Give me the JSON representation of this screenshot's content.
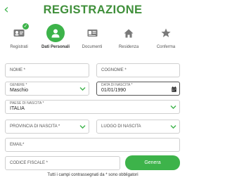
{
  "header": {
    "back_glyph": "‹",
    "title": "REGISTRAZIONE"
  },
  "steps": [
    {
      "label": "Registrati",
      "icon": "id-card-icon",
      "state": "done"
    },
    {
      "label": "Dati Personali",
      "icon": "user-icon",
      "state": "active"
    },
    {
      "label": "Documenti",
      "icon": "document-icon",
      "state": "pending"
    },
    {
      "label": "Residenza",
      "icon": "home-icon",
      "state": "pending"
    },
    {
      "label": "Conferma",
      "icon": "star-icon",
      "state": "pending"
    }
  ],
  "form": {
    "nome": {
      "placeholder": "NOME *"
    },
    "cognome": {
      "placeholder": "COGNOME *"
    },
    "genere": {
      "label": "GENERE *",
      "value": "Maschio"
    },
    "data_nascita": {
      "label": "DATA DI NASCITA *",
      "value": "01/01/1990"
    },
    "paese_nascita": {
      "label": "PAESE DI NASCITA *",
      "value": "ITALIA"
    },
    "provincia_nascita": {
      "placeholder": "PROVINCIA DI NASCITA *"
    },
    "luogo_nascita": {
      "placeholder": "LUOGO DI NASCITA"
    },
    "email": {
      "placeholder": "EMAIL*"
    },
    "codice_fiscale": {
      "placeholder": "CODICE FISCALE *"
    },
    "submit_label": "Genera",
    "footnote": "Tutti i campi contrassegnati da * sono obbligatori"
  },
  "colors": {
    "accent": "#3db34a",
    "title": "#3f8f3a",
    "icon_gray": "#7a7a7a"
  }
}
